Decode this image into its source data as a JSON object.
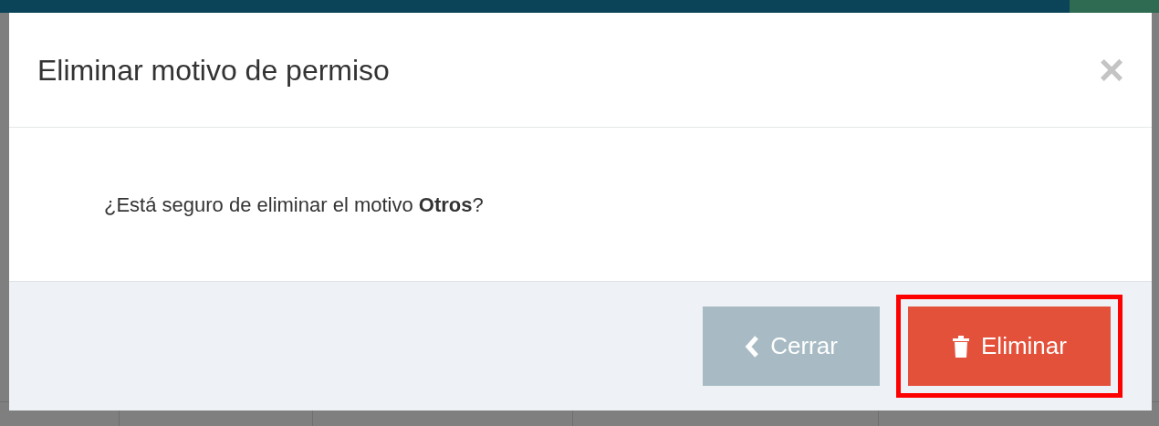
{
  "dialog": {
    "title": "Eliminar motivo de permiso",
    "close": "×",
    "message": "¿Está seguro de eliminar el motivo **Otros**?",
    "buttons": [
      {
        "kind": "secondary",
        "label": "Cerrar",
        "highlighted": false
      },
      {
        "kind": "danger",
        "label": "Eliminar",
        "highlighted": true
      }
    ]
  }
}
